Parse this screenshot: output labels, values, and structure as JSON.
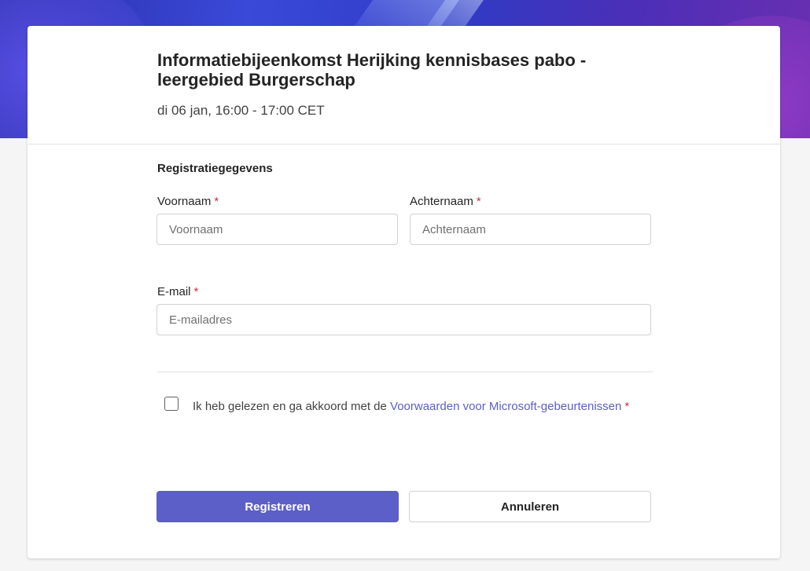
{
  "event": {
    "title": "Informatiebijeenkomst Herijking kennisbases pabo - leergebied Burgerschap",
    "datetime": "di 06 jan, 16:00 - 17:00 CET"
  },
  "form": {
    "section_title": "Registratiegegevens",
    "required_marker": "*",
    "first_name": {
      "label": "Voornaam",
      "placeholder": "Voornaam",
      "value": ""
    },
    "last_name": {
      "label": "Achternaam",
      "placeholder": "Achternaam",
      "value": ""
    },
    "email": {
      "label": "E-mail",
      "placeholder": "E-mailadres",
      "value": ""
    },
    "consent": {
      "text": "Ik heb gelezen en ga akkoord met de ",
      "link_text": "Voorwaarden voor Microsoft-gebeurtenissen",
      "checked": false
    }
  },
  "buttons": {
    "register": "Registreren",
    "cancel": "Annuleren"
  },
  "colors": {
    "accent": "#5b5fc7",
    "required": "#c4314b"
  }
}
